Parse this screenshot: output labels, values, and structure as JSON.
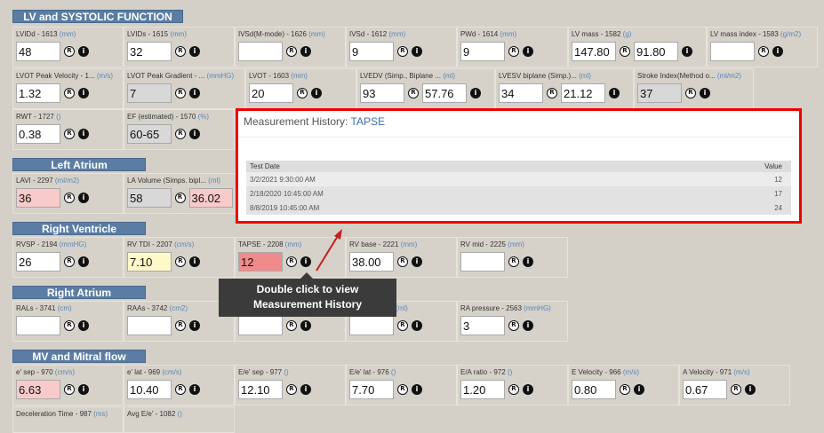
{
  "sections": {
    "lv": "LV and SYSTOLIC FUNCTION",
    "la": "Left Atrium",
    "rv": "Right Ventricle",
    "ra": "Right Atrium",
    "mv": "MV and Mitral flow"
  },
  "fields": {
    "lvidd": {
      "label": "LVIDd - 1613",
      "unit": "(mm)",
      "value": "48"
    },
    "lvids": {
      "label": "LVIDs - 1615",
      "unit": "(mm)",
      "value": "32"
    },
    "ivsd_m": {
      "label": "IVSd(M-mode) - 1626",
      "unit": "(mm)",
      "value": ""
    },
    "ivsd": {
      "label": "IVSd - 1612",
      "unit": "(mm)",
      "value": "9"
    },
    "pwd": {
      "label": "PWd - 1614",
      "unit": "(mm)",
      "value": "9"
    },
    "lvmass": {
      "label": "LV mass - 1582",
      "unit": "(g)",
      "value": "147.80",
      "value2": "91.80"
    },
    "lvmassidx": {
      "label": "LV mass index - 1583",
      "unit": "(g/m2)",
      "value": ""
    },
    "lvot_vel": {
      "label": "LVOT Peak Velocity - 1...",
      "unit": "(m/s)",
      "value": "1.32"
    },
    "lvot_grad": {
      "label": "LVOT Peak Gradient - ...",
      "unit": "(mmHG)",
      "value": "7"
    },
    "lvot": {
      "label": "LVOT - 1603",
      "unit": "(mm)",
      "value": "20"
    },
    "lvedv": {
      "label": "LVEDV (Simp., Biplane ...",
      "unit": "(ml)",
      "value": "93",
      "value2": "57.76"
    },
    "lvesv": {
      "label": "LVESV biplane (Simp.)...",
      "unit": "(ml)",
      "value": "34",
      "value2": "21.12"
    },
    "svi": {
      "label": "Stroke Index(Method o...",
      "unit": "(ml/m2)",
      "value": "37"
    },
    "rwt": {
      "label": "RWT - 1727",
      "unit": "()",
      "value": "0.38"
    },
    "ef": {
      "label": "EF (estimated) - 1570",
      "unit": "(%)",
      "value": "60-65"
    },
    "lavi": {
      "label": "LAVI - 2297",
      "unit": "(ml/m2)",
      "value": "36"
    },
    "lavol": {
      "label": "LA Volume (Simps. bipl...",
      "unit": "(ml)",
      "value": "58",
      "value2": "36.02"
    },
    "rvsp": {
      "label": "RVSP - 2194",
      "unit": "(mmHG)",
      "value": "26"
    },
    "rvtdi": {
      "label": "RV TDI - 2207",
      "unit": "(cm/s)",
      "value": "7.10"
    },
    "tapse": {
      "label": "TAPSE - 2208",
      "unit": "(mm)",
      "value": "12"
    },
    "rvbase": {
      "label": "RV base - 2221",
      "unit": "(mm)",
      "value": "38.00"
    },
    "rvmid": {
      "label": "RV mid - 2225",
      "unit": "(mm)",
      "value": ""
    },
    "rals": {
      "label": "RALs - 3741",
      "unit": "(cm)",
      "value": ""
    },
    "raas": {
      "label": "RAAs - 3742",
      "unit": "(cm2)",
      "value": ""
    },
    "ra3": {
      "label": "",
      "unit": "",
      "value": ""
    },
    "ra4": {
      "label": "y MOD - 3744",
      "unit": "(ml)",
      "value": ""
    },
    "rap": {
      "label": "RA pressure - 2563",
      "unit": "(mmHG)",
      "value": "3"
    },
    "esep": {
      "label": "e' sep - 970",
      "unit": "(cm/s)",
      "value": "6.63"
    },
    "elat": {
      "label": "e' lat - 969",
      "unit": "(cm/s)",
      "value": "10.40"
    },
    "eesep": {
      "label": "E/e' sep - 977",
      "unit": "()",
      "value": "12.10"
    },
    "eelat": {
      "label": "E/e' lat - 976",
      "unit": "()",
      "value": "7.70"
    },
    "ea": {
      "label": "E/A ratio - 972",
      "unit": "()",
      "value": "1.20"
    },
    "evel": {
      "label": "E Velocity - 966",
      "unit": "(m/s)",
      "value": "0.80"
    },
    "avel": {
      "label": "A Velocity - 971",
      "unit": "(m/s)",
      "value": "0.67"
    },
    "dt": {
      "label": "Deceleration Time - 987",
      "unit": "(ms)",
      "value": ""
    },
    "avgee": {
      "label": "Avg E/e' - 1082",
      "unit": "()",
      "value": ""
    }
  },
  "history": {
    "title_prefix": "Measurement History: ",
    "title_name": "TAPSE",
    "col_date": "Test Date",
    "col_value": "Value",
    "rows": [
      {
        "date": "3/2/2021 9:30:00 AM",
        "value": "12"
      },
      {
        "date": "2/18/2020 10:45:00 AM",
        "value": "17"
      },
      {
        "date": "8/8/2019 10:45:00 AM",
        "value": "24"
      }
    ]
  },
  "tooltip": {
    "line1": "Double click to view",
    "line2": "Measurement History"
  },
  "icons": {
    "r": "R",
    "i": "i"
  }
}
